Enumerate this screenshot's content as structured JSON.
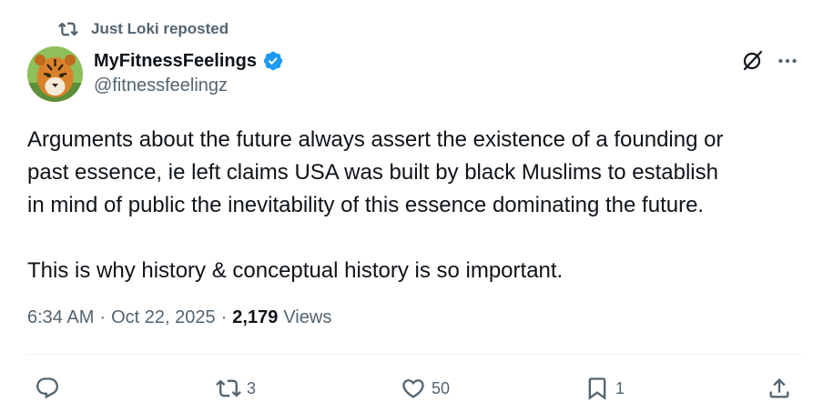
{
  "repost": {
    "text": "Just Loki reposted",
    "icon": "repost-icon"
  },
  "author": {
    "display_name": "MyFitnessFeelings",
    "handle": "@fitnessfeelingz",
    "verified": true,
    "verified_color": "#1d9bf0",
    "avatar": "tiger-avatar"
  },
  "header_actions": {
    "grok": "grok-icon",
    "more": "more-icon"
  },
  "tweet": {
    "lines": [
      "Arguments about the future always assert the existence of a founding or",
      "past essence, ie left claims USA was built by black Muslims to establish",
      "in mind of public the inevitability of this essence dominating the future.",
      "This is why history & conceptual history is so important."
    ]
  },
  "meta": {
    "time": "6:34 AM",
    "separator": "·",
    "date": "Oct 22, 2025",
    "views_count": "2,179",
    "views_label": "Views"
  },
  "actions": {
    "reply": {
      "icon": "reply-icon",
      "count": ""
    },
    "repost": {
      "icon": "repost-icon",
      "count": "3"
    },
    "like": {
      "icon": "heart-icon",
      "count": "50"
    },
    "bookmark": {
      "icon": "bookmark-icon",
      "count": "1"
    },
    "share": {
      "icon": "share-icon"
    }
  },
  "colors": {
    "text": "#0f1419",
    "secondary": "#536471",
    "accent": "#1d9bf0",
    "divider": "#eff3f4"
  }
}
